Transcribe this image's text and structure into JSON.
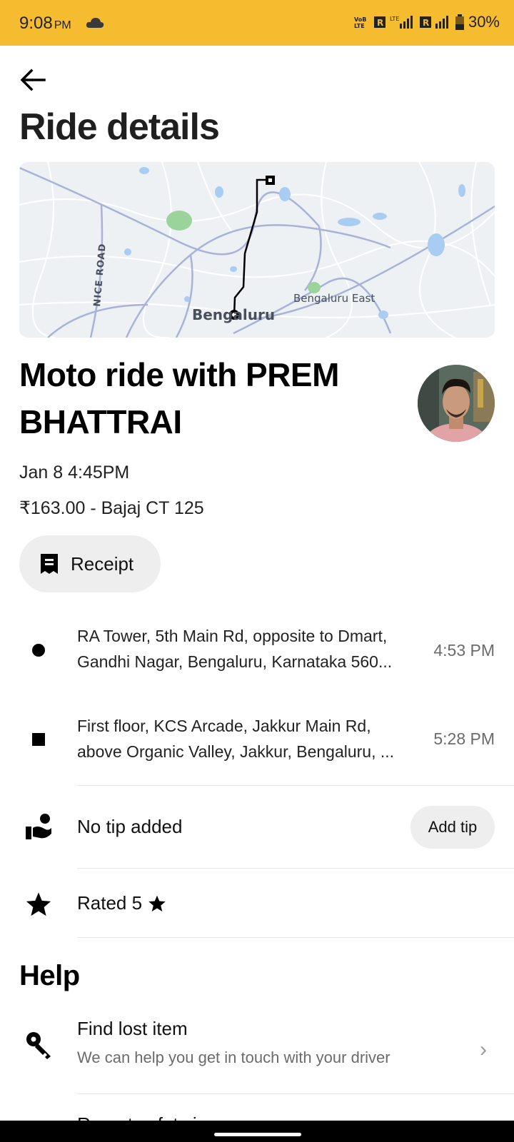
{
  "status_bar": {
    "time": "9:08",
    "ampm": "PM",
    "battery": "30%",
    "bg_color": "#F6BC2F"
  },
  "header": {
    "back_icon": "arrow-left-icon",
    "title": "Ride details"
  },
  "map": {
    "labels": [
      "NICE ROAD",
      "Bengaluru East",
      "Bengaluru"
    ]
  },
  "ride": {
    "title": "Moto ride with PREM BHATTRAI",
    "date": "Jan 8 4:45PM",
    "fare_vehicle": "₹163.00 - Bajaj CT 125",
    "receipt_label": "Receipt"
  },
  "stops": [
    {
      "line1": "RA Tower, 5th Main Rd, opposite to Dmart,",
      "line2": "Gandhi Nagar, Bengaluru, Karnataka 560...",
      "time": "4:53 PM"
    },
    {
      "line1": "First floor, KCS Arcade, Jakkur Main Rd,",
      "line2": "above Organic Valley, Jakkur, Bengaluru, ...",
      "time": "5:28 PM"
    }
  ],
  "tip": {
    "label": "No tip added",
    "button": "Add tip"
  },
  "rating": {
    "label": "Rated 5"
  },
  "help": {
    "title": "Help",
    "items": [
      {
        "title": "Find lost item",
        "subtitle": "We can help you get in touch with your driver"
      },
      {
        "title": "Report safety issue"
      }
    ]
  }
}
